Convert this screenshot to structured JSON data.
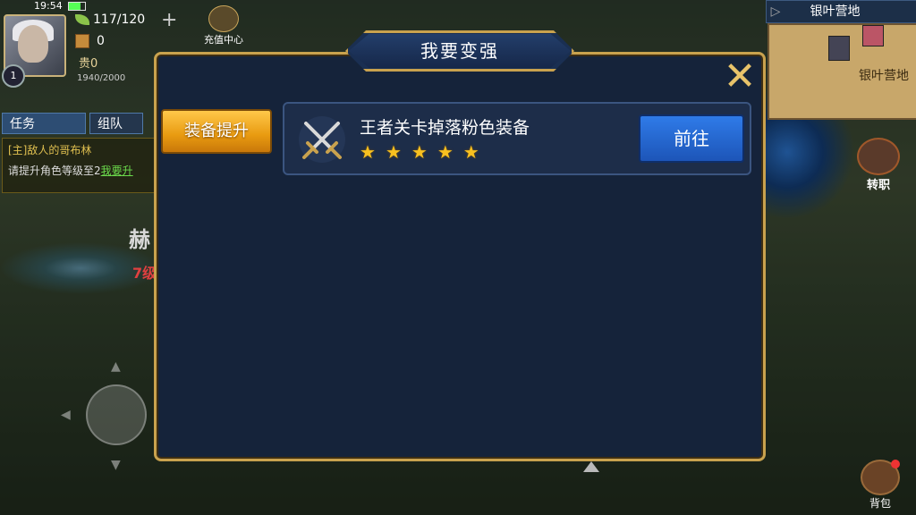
{
  "status": {
    "time": "19:54"
  },
  "player": {
    "level": "1",
    "stamina": "117/120",
    "gold": "0",
    "vip": "贵0",
    "exp": "1940/2000"
  },
  "recharge": {
    "label": "充值中心"
  },
  "quest": {
    "tabs": [
      "任务",
      "组队"
    ],
    "title": "[主]敌人的哥布林",
    "text": "请提升角色等级至2",
    "link": "我要升"
  },
  "background": {
    "name_partial": "赫",
    "level_partial": "7级"
  },
  "map": {
    "title": "银叶营地",
    "label": "银叶营地"
  },
  "right_buttons": {
    "job": "转职",
    "bag": "背包"
  },
  "modal": {
    "title": "我要变强",
    "side_button": "装备提升",
    "items": [
      {
        "title": "王者关卡掉落粉色装备",
        "stars": 5,
        "button": "前往"
      }
    ]
  },
  "colors": {
    "gold_frame": "#c9a24e",
    "panel": "#15233a",
    "orange_btn": "#e89a10",
    "blue_btn": "#2f7be8",
    "star": "#f8c020"
  }
}
